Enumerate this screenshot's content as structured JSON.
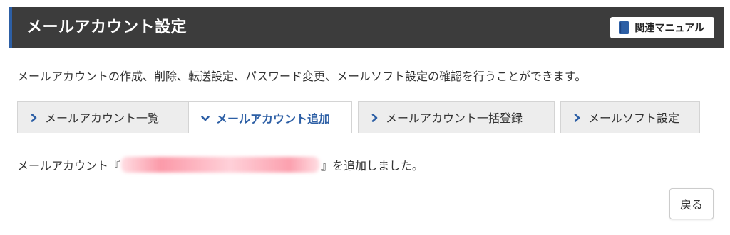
{
  "header": {
    "title": "メールアカウント設定",
    "manual_button_label": "関連マニュアル",
    "manual_icon": "book-icon",
    "accent_color": "#2d5fa5",
    "background_color": "#3c3c3c"
  },
  "description": "メールアカウントの作成、削除、転送設定、パスワード変更、メールソフト設定の確認を行うことができます。",
  "tabs": [
    {
      "label": "メールアカウント一覧",
      "icon": "chevron-right-icon",
      "active": false
    },
    {
      "label": "メールアカウント追加",
      "icon": "chevron-down-icon",
      "active": true
    },
    {
      "label": "メールアカウント一括登録",
      "icon": "chevron-right-icon",
      "active": false
    },
    {
      "label": "メールソフト設定",
      "icon": "chevron-right-icon",
      "active": false
    }
  ],
  "message": {
    "prefix": "メールアカウント『",
    "suffix": "』を追加しました。"
  },
  "back_button_label": "戻る"
}
